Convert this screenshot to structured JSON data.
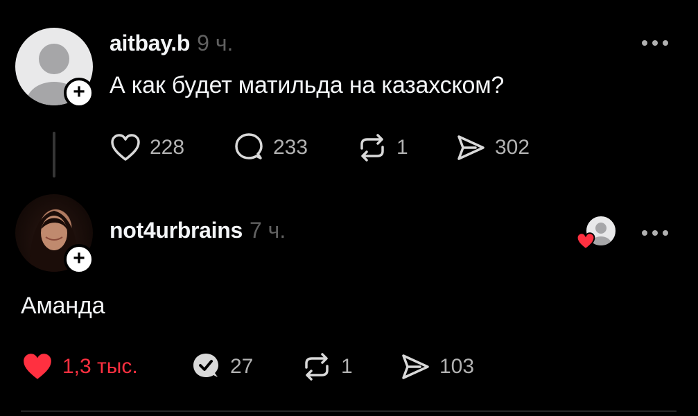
{
  "post": {
    "username": "aitbay.b",
    "time": "9 ч.",
    "text": "А как будет матильда на казахском?",
    "more_icon": "more-horizontal-icon",
    "likes": "228",
    "comments": "233",
    "reposts": "1",
    "shares": "302"
  },
  "reply": {
    "username": "not4urbrains",
    "time": "7 ч.",
    "text": "Аманда",
    "likes": "1,3 тыс.",
    "comments": "27",
    "reposts": "1",
    "shares": "103",
    "liked": true
  },
  "colors": {
    "background": "#000000",
    "primary_text": "#f3f5f7",
    "secondary_text": "#616161",
    "counts": "#b3b3b3",
    "like_red": "#ff3040"
  }
}
